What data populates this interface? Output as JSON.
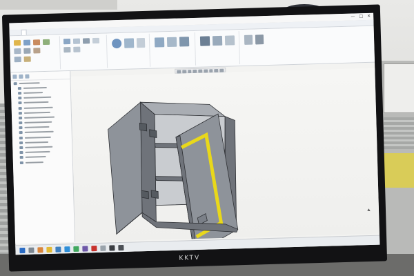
{
  "app": {
    "window_title": "",
    "window_buttons": [
      "—",
      "□",
      "✕"
    ],
    "menu_tabs": [
      "",
      "",
      "",
      "",
      "",
      "",
      ""
    ],
    "ribbon_groups": [
      "",
      "",
      "",
      "",
      "",
      ""
    ],
    "brand": "KKTV"
  },
  "model": {
    "label": "",
    "colors": {
      "body": "#8e939a",
      "body_dark": "#6f737a",
      "body_light": "#a9adb3",
      "interior": "#c9ccd0",
      "highlight": "#e9d81a",
      "outline": "#2d2f33"
    }
  },
  "taskbar": {
    "apps": [
      "windows-icon",
      "search-icon",
      "browser-icon",
      "explorer-icon",
      "cad-icon",
      "mail-icon",
      "chat-icon",
      "media-icon",
      "app-red-icon",
      "app-grey-icon",
      "app-dark-icon",
      "app-dark2-icon"
    ],
    "tray_text": "",
    "clock_time": "",
    "clock_date": ""
  }
}
